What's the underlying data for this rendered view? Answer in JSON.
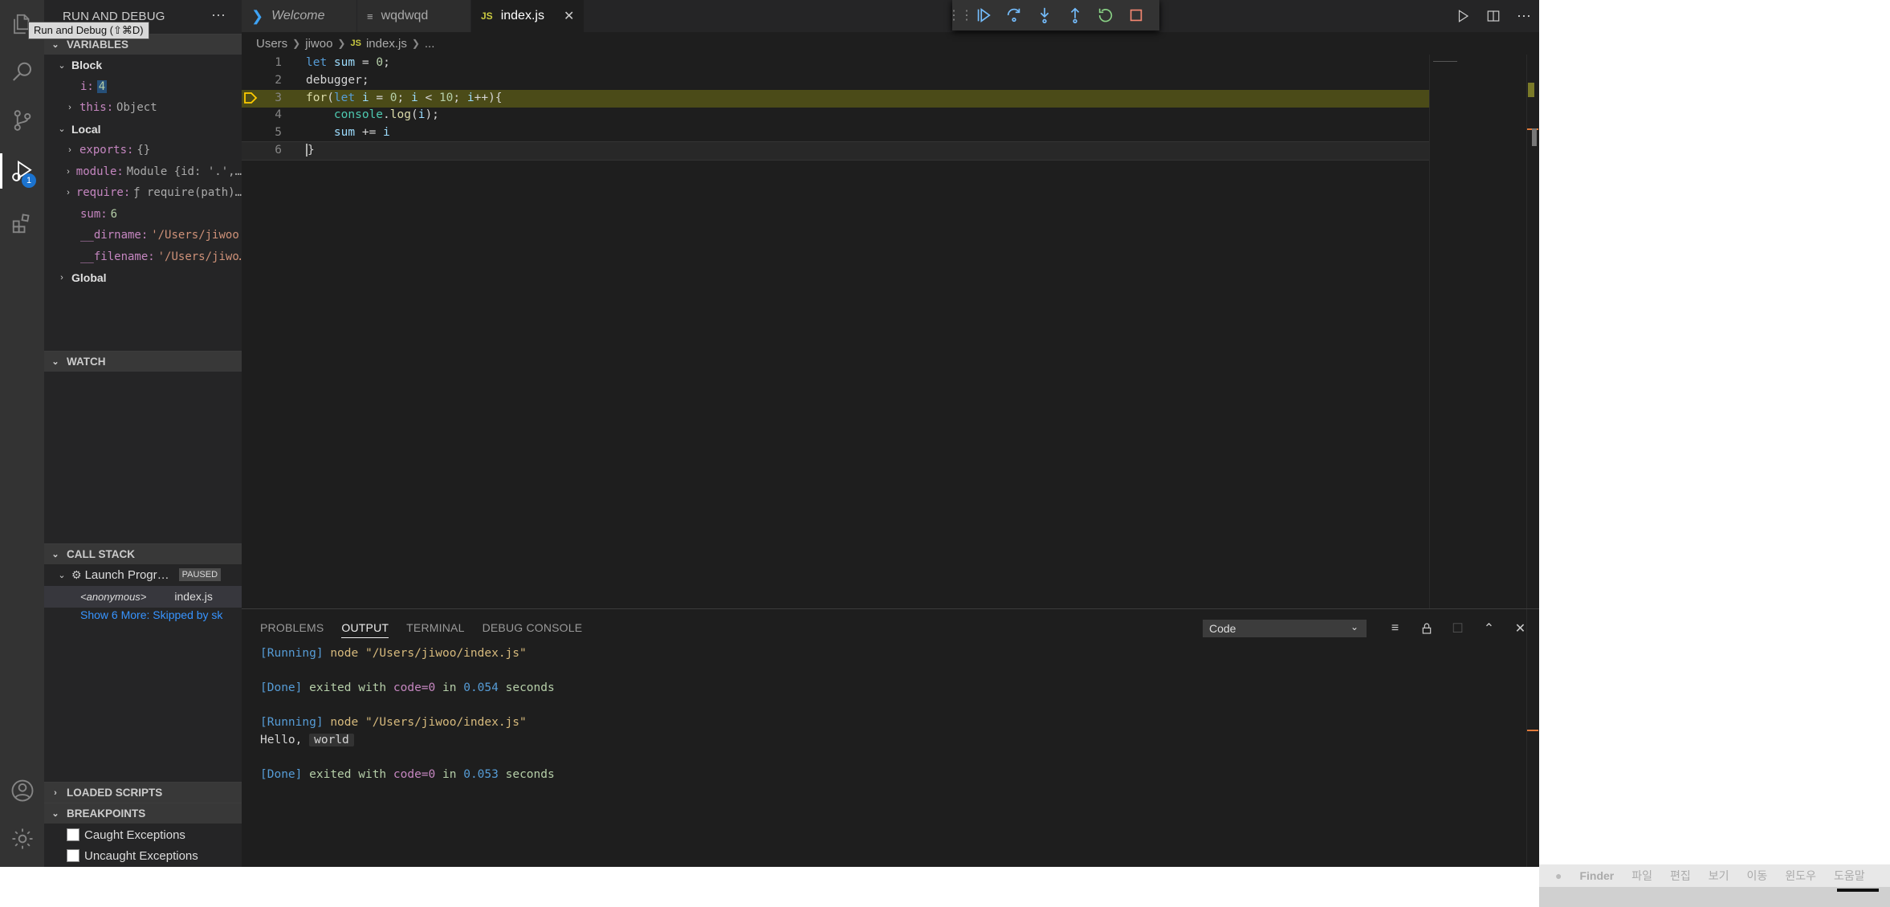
{
  "tooltip": "Run and Debug (⇧⌘D)",
  "activity_badge": "1",
  "sidebar": {
    "title": "RUN AND DEBUG",
    "more": "···",
    "variables_title": "VARIABLES",
    "block_label": "Block",
    "block_vars": [
      {
        "name": "i:",
        "value": "4"
      },
      {
        "name": "this:",
        "value": "Object"
      }
    ],
    "local_label": "Local",
    "local_vars": [
      {
        "name": "exports:",
        "value": "{}"
      },
      {
        "name": "module:",
        "value": "Module {id: '.',…"
      },
      {
        "name": "require:",
        "value": "ƒ require(path)…"
      },
      {
        "name": "sum:",
        "value": "6"
      },
      {
        "name": "__dirname:",
        "value": "'/Users/jiwoo'"
      },
      {
        "name": "__filename:",
        "value": "'/Users/jiwo…"
      }
    ],
    "global_label": "Global",
    "watch_title": "WATCH",
    "callstack_title": "CALL STACK",
    "launch_label": "Launch Progr…",
    "paused_badge": "PAUSED",
    "frame_name": "<anonymous>",
    "frame_file": "index.js",
    "show_more": "Show 6 More: Skipped by sk",
    "loaded_scripts_title": "LOADED SCRIPTS",
    "breakpoints_title": "BREAKPOINTS",
    "caught": "Caught Exceptions",
    "uncaught": "Uncaught Exceptions"
  },
  "tabs": [
    {
      "label": "Welcome",
      "icon": "vscode-icon"
    },
    {
      "label": "wqdwqd",
      "icon": "file-icon"
    },
    {
      "label": "index.js",
      "icon": "JS"
    }
  ],
  "breadcrumb": [
    "Users",
    "jiwoo",
    "index.js",
    "..."
  ],
  "breadcrumb_js": "JS",
  "code_lines": [
    {
      "n": "1",
      "tokens": [
        [
          "kw",
          "let "
        ],
        [
          "id",
          "sum"
        ],
        [
          "plain",
          " = "
        ],
        [
          "num",
          "0"
        ],
        [
          "plain",
          ";"
        ]
      ]
    },
    {
      "n": "2",
      "tokens": [
        [
          "plain",
          "debugger;"
        ]
      ]
    },
    {
      "n": "3",
      "tokens": [
        [
          "fn",
          "for"
        ],
        [
          "plain",
          "("
        ],
        [
          "kw",
          "let "
        ],
        [
          "id",
          "i"
        ],
        [
          "plain",
          " = "
        ],
        [
          "num",
          "0"
        ],
        [
          "plain",
          "; "
        ],
        [
          "id",
          "i"
        ],
        [
          "plain",
          " < "
        ],
        [
          "num",
          "10"
        ],
        [
          "plain",
          "; "
        ],
        [
          "id",
          "i"
        ],
        [
          "plain",
          "++){"
        ]
      ]
    },
    {
      "n": "4",
      "tokens": [
        [
          "plain",
          "    "
        ],
        [
          "obj",
          "console"
        ],
        [
          "plain",
          "."
        ],
        [
          "fn",
          "log"
        ],
        [
          "plain",
          "("
        ],
        [
          "id",
          "i"
        ],
        [
          "plain",
          ");"
        ]
      ]
    },
    {
      "n": "5",
      "tokens": [
        [
          "plain",
          "    "
        ],
        [
          "id",
          "sum"
        ],
        [
          "plain",
          " += "
        ],
        [
          "id",
          "i"
        ]
      ]
    },
    {
      "n": "6",
      "tokens": [
        [
          "plain",
          "}"
        ]
      ]
    }
  ],
  "panel": {
    "tabs": [
      "PROBLEMS",
      "OUTPUT",
      "TERMINAL",
      "DEBUG CONSOLE"
    ],
    "active_tab": "OUTPUT",
    "select_value": "Code"
  },
  "output": {
    "run1_tag": "[Running]",
    "run1_cmd": "node \"/Users/jiwoo/index.js\"",
    "done1_tag": "[Done]",
    "done1_a": "exited with",
    "done1_code": "code=0",
    "done1_b": "in",
    "done1_time": "0.054",
    "done1_c": "seconds",
    "run2_tag": "[Running]",
    "run2_cmd": "node \"/Users/jiwoo/index.js\"",
    "hello": "Hello,",
    "world": "world",
    "done2_tag": "[Done]",
    "done2_a": "exited with",
    "done2_code": "code=0",
    "done2_b": "in",
    "done2_time": "0.053",
    "done2_c": "seconds"
  },
  "mac_menu": [
    "Finder",
    "파일",
    "편집",
    "보기",
    "이동",
    "윈도우",
    "도움말"
  ],
  "colors": {
    "accent": "#1b73cf",
    "paused_line": "#4b4b18",
    "breakpoint": "#ffcc00"
  }
}
